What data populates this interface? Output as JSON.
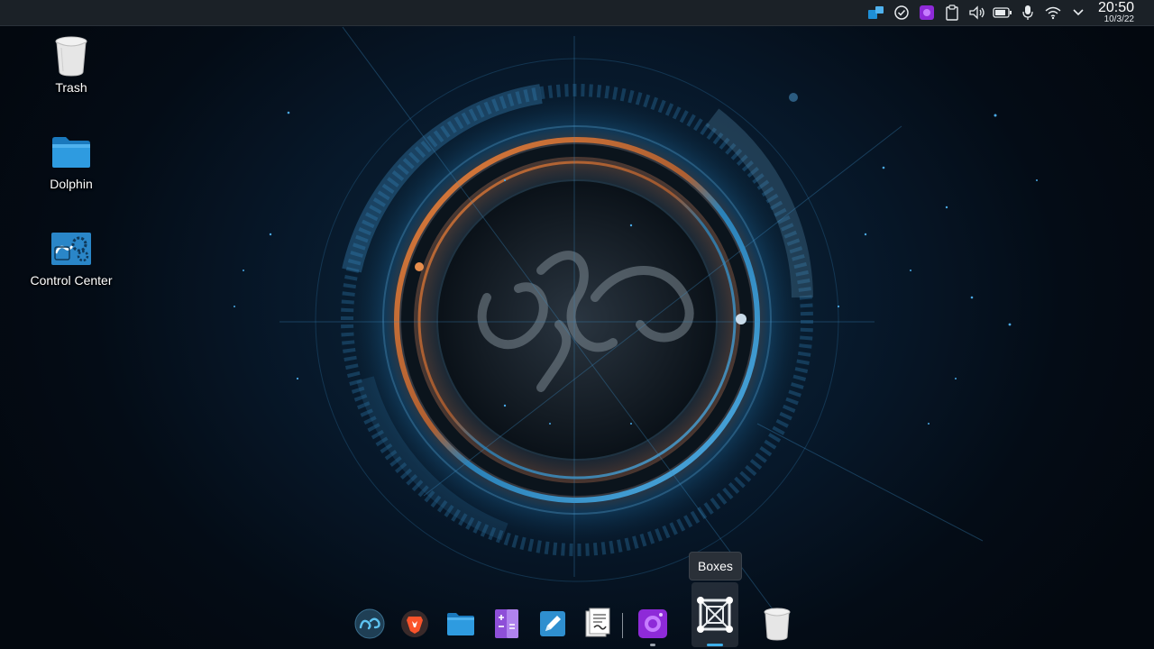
{
  "desktop": {
    "icons": [
      {
        "label": "Trash",
        "icon": "trash-icon"
      },
      {
        "label": "Dolphin",
        "icon": "folder-icon"
      },
      {
        "label": "Control Center",
        "icon": "control-center-icon"
      }
    ]
  },
  "top_panel": {
    "tray": [
      "window-switcher-icon",
      "updates-check-icon",
      "boxes-tray-icon",
      "clipboard-icon",
      "volume-icon",
      "battery-icon",
      "microphone-icon",
      "wifi-icon",
      "expand-tray-icon"
    ],
    "clock": {
      "time": "20:50",
      "date": "10/3/22"
    }
  },
  "dock": {
    "items": [
      {
        "name": "biglinux-menu-icon",
        "app": "BigLinux menu"
      },
      {
        "name": "brave-browser-icon",
        "app": "Brave"
      },
      {
        "name": "dolphin-file-manager-icon",
        "app": "Dolphin"
      },
      {
        "name": "calculator-icon",
        "app": "Calculator"
      },
      {
        "name": "text-editor-icon",
        "app": "Text editor"
      },
      {
        "name": "document-viewer-icon",
        "app": "Documents"
      },
      {
        "name": "screen-recorder-icon",
        "app": "Recorder"
      },
      {
        "name": "boxes-icon",
        "app": "Boxes"
      },
      {
        "name": "trash-dock-icon",
        "app": "Trash"
      }
    ],
    "tooltip": "Boxes"
  },
  "colors": {
    "panel": "#1b2127",
    "accent": "#3daee9",
    "folder_blue": "#1e8fd6",
    "purple": "#8e2ad8",
    "wallpaper_orange": "#e07a3a",
    "wallpaper_blue": "#2a9ad6"
  }
}
